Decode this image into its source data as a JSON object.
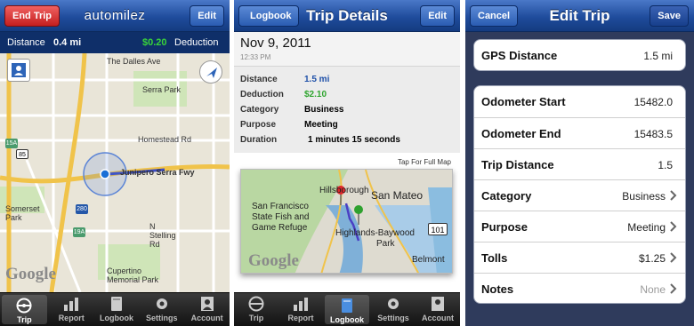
{
  "screen1": {
    "brand": "automilez",
    "end_trip_label": "End Trip",
    "edit_label": "Edit",
    "distance_label": "Distance",
    "distance_value": "0.4 mi",
    "deduction_value": "$0.20",
    "deduction_label": "Deduction",
    "map_labels": {
      "dalles": "The Dalles Ave",
      "serra": "Serra Park",
      "homestead": "Homestead Rd",
      "junipero": "Junipero Serra Fwy",
      "somerset": "Somerset Park",
      "stelling": "N Stelling Rd",
      "cupertino": "Cupertino Memorial Park",
      "google": "Google"
    },
    "shields": {
      "s85": "85",
      "s280": "280",
      "s15a": "15A",
      "s19": "19A"
    }
  },
  "screen2": {
    "back_label": "Logbook",
    "title": "Trip Details",
    "edit_label": "Edit",
    "date": "Nov 9, 2011",
    "time": "12:33 PM",
    "rows": [
      {
        "k": "Distance",
        "v": "1.5 mi"
      },
      {
        "k": "Deduction",
        "v": "$2.10"
      },
      {
        "k": "Category",
        "v": "Business"
      },
      {
        "k": "Purpose",
        "v": "Meeting"
      },
      {
        "k": "Duration",
        "v": "1 minutes 15 seconds"
      }
    ],
    "map_caption": "Tap For Full Map",
    "map_labels": {
      "sanmateo": "San Mateo",
      "hillsborough": "Hillsborough",
      "sanfran": "San Francisco",
      "statefish": "State Fish and",
      "gamerefuge": "Game Refuge",
      "highlands": "Highlands-Baywood",
      "park": "Park",
      "belmont": "Belmont",
      "r101": "101",
      "google": "Google"
    }
  },
  "screen3": {
    "cancel_label": "Cancel",
    "title": "Edit Trip",
    "save_label": "Save",
    "gps": {
      "k": "GPS Distance",
      "v": "1.5 mi"
    },
    "fields": [
      {
        "k": "Odometer Start",
        "v": "15482.0"
      },
      {
        "k": "Odometer End",
        "v": "15483.5"
      },
      {
        "k": "Trip Distance",
        "v": "1.5"
      },
      {
        "k": "Category",
        "v": "Business"
      },
      {
        "k": "Purpose",
        "v": "Meeting"
      },
      {
        "k": "Tolls",
        "v": "$1.25"
      },
      {
        "k": "Notes",
        "v": "None"
      }
    ]
  },
  "tabs": [
    "Trip",
    "Report",
    "Logbook",
    "Settings",
    "Account"
  ],
  "colors": {
    "nav": "#1f4c9c",
    "green": "#2fb22f",
    "accent_blue": "#1d4fa8"
  }
}
